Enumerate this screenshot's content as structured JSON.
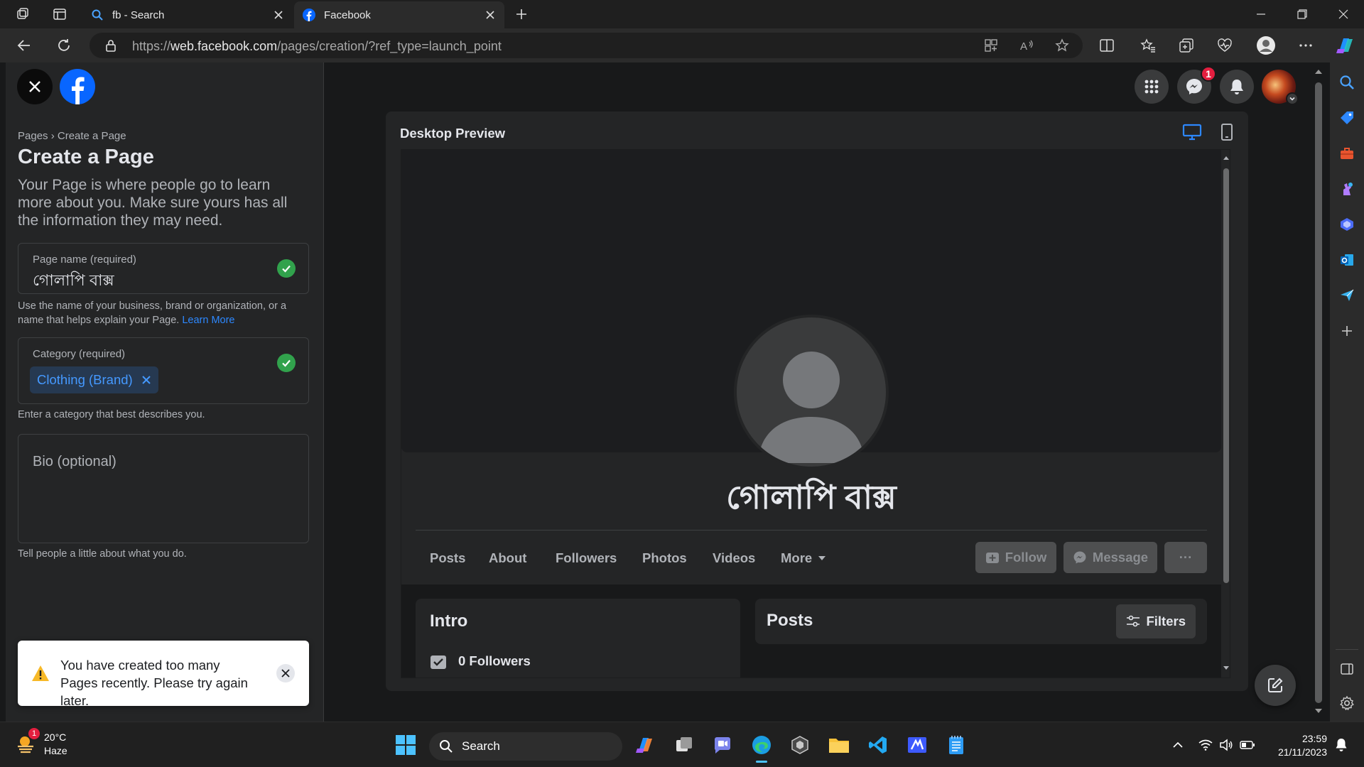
{
  "browser": {
    "tabs": [
      {
        "title": "fb - Search",
        "active": false
      },
      {
        "title": "Facebook",
        "active": true
      }
    ],
    "url_prefix": "https://",
    "url_domain": "web.facebook.com",
    "url_path": "/pages/creation/?ref_type=launch_point"
  },
  "left_panel": {
    "breadcrumb": "Pages › Create a Page",
    "title": "Create a Page",
    "description": "Your Page is where people go to learn more about you. Make sure yours has all the information they may need.",
    "page_name_label": "Page name (required)",
    "page_name_value": "গোলাপি বাক্স",
    "page_name_hint": "Use the name of your business, brand or organization, or a name that helps explain your Page. ",
    "learn_more": "Learn More",
    "category_label": "Category (required)",
    "category_chip": "Clothing (Brand)",
    "category_hint": "Enter a category that best describes you.",
    "bio_placeholder": "Bio (optional)",
    "bio_hint": "Tell people a little about what you do."
  },
  "toast": {
    "message": "You have created too many Pages recently. Please try again later."
  },
  "topbar": {
    "messenger_badge": "1"
  },
  "preview": {
    "label": "Desktop Preview",
    "page_name": "গোলাপি বাক্স",
    "tabs": [
      "Posts",
      "About",
      "Followers",
      "Photos",
      "Videos",
      "More"
    ],
    "follow_label": "Follow",
    "message_label": "Message",
    "more_label": "···",
    "intro_heading": "Intro",
    "followers_text": "0 Followers",
    "posts_heading": "Posts",
    "filters_label": "Filters"
  },
  "taskbar": {
    "weather_temp": "20°C",
    "weather_desc": "Haze",
    "weather_badge": "1",
    "search_label": "Search",
    "time": "23:59",
    "date": "21/11/2023"
  },
  "colors": {
    "fb_blue": "#0866ff",
    "success_green": "#31a24c",
    "chip_text": "#4599ff",
    "warning_yellow": "#f7b928",
    "badge_red": "#e41e3f"
  }
}
